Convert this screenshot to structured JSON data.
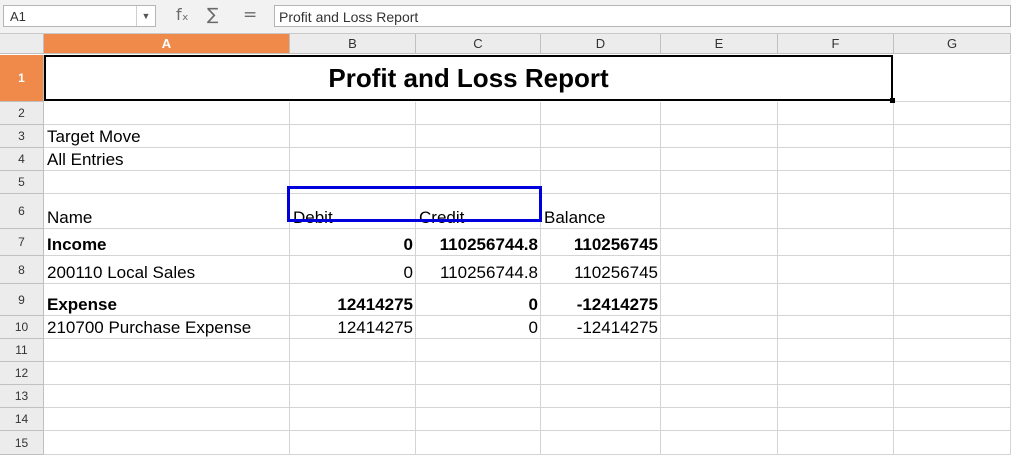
{
  "formula_bar": {
    "name_box": "A1",
    "function_wizard_icon": "fₓ",
    "sum_icon": "∑",
    "equals_icon": "=",
    "content": "Profit and Loss Report"
  },
  "columns": [
    "A",
    "B",
    "C",
    "D",
    "E",
    "F",
    "G"
  ],
  "selected_cell": "A1",
  "rows": [
    "1",
    "2",
    "3",
    "4",
    "5",
    "6",
    "7",
    "8",
    "9",
    "10",
    "11",
    "12",
    "13",
    "14",
    "15"
  ],
  "report": {
    "title": "Profit and Loss Report",
    "target_move_label": "Target Move",
    "target_move_value": "All Entries",
    "headers": {
      "name": "Name",
      "debit": "Debit",
      "credit": "Credit",
      "balance": "Balance"
    },
    "lines": [
      {
        "name": "Income",
        "debit": "0",
        "credit": "110256744.8",
        "balance": "110256745",
        "bold": true
      },
      {
        "name": "200110 Local Sales",
        "debit": "0",
        "credit": "110256744.8",
        "balance": "110256745",
        "bold": false
      },
      {
        "name": "Expense",
        "debit": "12414275",
        "credit": "0",
        "balance": "-12414275",
        "bold": true
      },
      {
        "name": "210700 Purchase Expense",
        "debit": "12414275",
        "credit": "0",
        "balance": "-12414275",
        "bold": false
      }
    ]
  },
  "annotation": {
    "highlight_color": "#0000dd",
    "highlighted_cells": [
      "B6",
      "C6"
    ]
  },
  "colors": {
    "selected_header": "#f08a4b",
    "header_bg": "#ececec",
    "grid": "#d4d4d4"
  }
}
